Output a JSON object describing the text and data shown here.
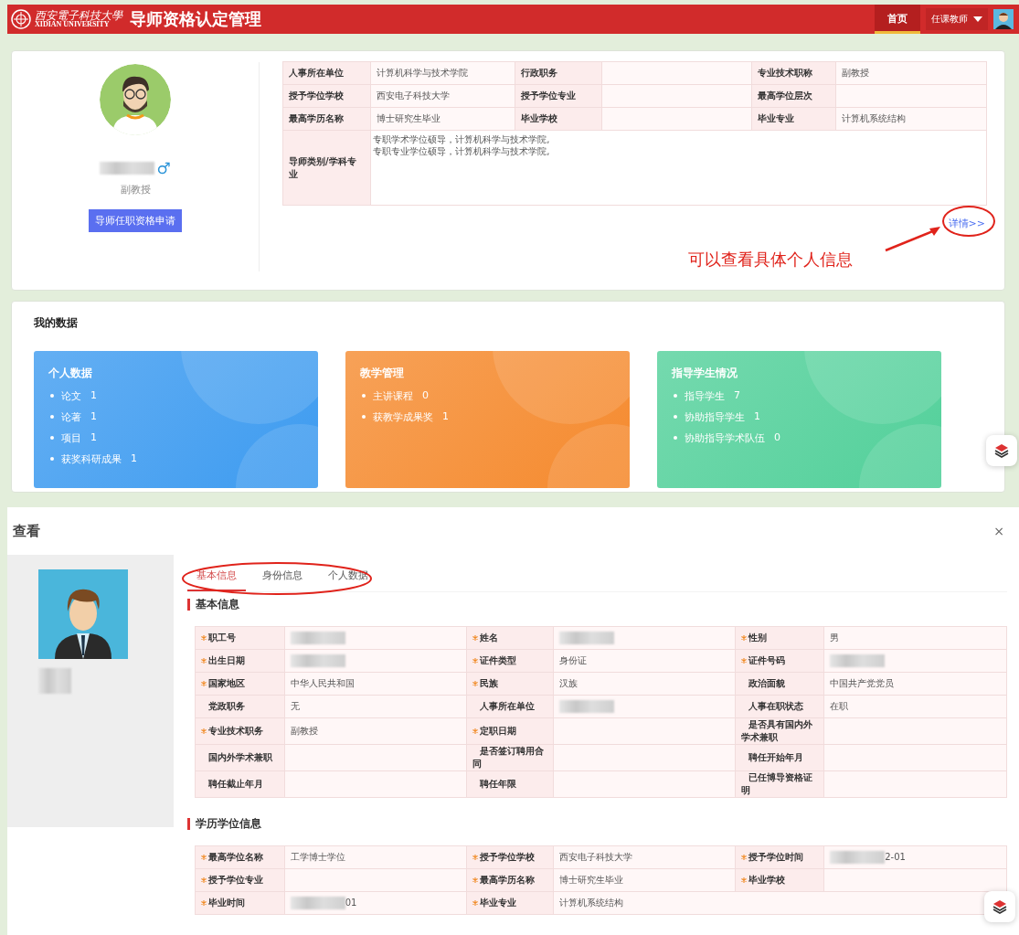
{
  "header": {
    "logo_cn": "西安電子科技大學",
    "logo_en": "XIDIAN UNIVERSITY",
    "title": "导师资格认定管理",
    "nav": [
      {
        "label": "首页",
        "selected": true
      }
    ],
    "role": "任课教师"
  },
  "profile": {
    "name_redacted": true,
    "gender": "♂",
    "rank": "副教授",
    "apply_button": "导师任职资格申请",
    "info_rows": [
      [
        {
          "label": "人事所在单位",
          "value": "计算机科学与技术学院"
        },
        {
          "label": "行政职务"
        },
        {
          "label": "专业技术职称",
          "value": "副教授"
        }
      ],
      [
        {
          "label": "授予学位学校",
          "value": "西安电子科技大学"
        },
        {
          "label": "授予学位专业"
        },
        {
          "label": "最高学位层次"
        }
      ],
      [
        {
          "label": "最高学历名称",
          "value": "博士研究生毕业"
        },
        {
          "label": "毕业学校"
        },
        {
          "label": "毕业专业",
          "value": "计算机系统结构"
        }
      ]
    ],
    "tutor_row": {
      "label": "导师类别/学科专业",
      "lines": [
        "专职学术学位硕导，计算机科学与技术学院,",
        "专职专业学位硕导，计算机科学与技术学院,"
      ]
    },
    "details_link": "详情>>",
    "annotation": "可以查看具体个人信息"
  },
  "my_data": {
    "title": "我的数据",
    "cards": [
      {
        "title": "个人数据",
        "color": "#3d9bf0",
        "items": [
          {
            "label": "论文",
            "count": "1"
          },
          {
            "label": "论著",
            "count": "1"
          },
          {
            "label": "项目",
            "count": "1"
          },
          {
            "label": "获奖科研成果",
            "count": "1"
          }
        ]
      },
      {
        "title": "教学管理",
        "color": "#f58a2e",
        "items": [
          {
            "label": "主讲课程",
            "count": "0"
          },
          {
            "label": "获教学成果奖",
            "count": "1"
          }
        ]
      },
      {
        "title": "指导学生情况",
        "color": "#52d09a",
        "items": [
          {
            "label": "指导学生",
            "count": "7"
          },
          {
            "label": "协助指导学生",
            "count": "1"
          },
          {
            "label": "协助指导学术队伍",
            "count": "0"
          }
        ]
      }
    ]
  },
  "dialog": {
    "title": "查看",
    "close": "×",
    "photo_caption_redacted": true,
    "tabs": [
      {
        "label": "基本信息",
        "selected": true
      },
      {
        "label": "身份信息",
        "selected": false
      },
      {
        "label": "个人数据",
        "selected": false
      }
    ],
    "sections": [
      {
        "title": "基本信息",
        "rows": [
          [
            {
              "label": "职工号",
              "required": true,
              "redacted": true
            },
            {
              "label": "姓名",
              "required": true,
              "redacted": true
            },
            {
              "label": "性别",
              "required": true,
              "value": "男"
            }
          ],
          [
            {
              "label": "出生日期",
              "required": true,
              "redacted": true
            },
            {
              "label": "证件类型",
              "required": true,
              "value": "身份证"
            },
            {
              "label": "证件号码",
              "required": true,
              "redacted": true
            }
          ],
          [
            {
              "label": "国家地区",
              "required": true,
              "value": "中华人民共和国"
            },
            {
              "label": "民族",
              "required": true,
              "value": "汉族"
            },
            {
              "label": "政治面貌",
              "required": false,
              "value": "中国共产党党员"
            }
          ],
          [
            {
              "label": "党政职务",
              "required": false,
              "value": "无"
            },
            {
              "label": "人事所在单位",
              "required": false,
              "redacted": true
            },
            {
              "label": "人事在职状态",
              "required": false,
              "value": "在职"
            }
          ],
          [
            {
              "label": "专业技术职务",
              "required": true,
              "value": "副教授"
            },
            {
              "label": "定职日期",
              "required": true
            },
            {
              "label": "是否具有国内外学术兼职",
              "required": false
            }
          ],
          [
            {
              "label": "国内外学术兼职",
              "required": false
            },
            {
              "label": "是否签订聘用合同",
              "required": false
            },
            {
              "label": "聘任开始年月",
              "required": false
            }
          ],
          [
            {
              "label": "聘任截止年月",
              "required": false
            },
            {
              "label": "聘任年限",
              "required": false
            },
            {
              "label": "已任博导资格证明",
              "required": false
            }
          ]
        ]
      },
      {
        "title": "学历学位信息",
        "rows": [
          [
            {
              "label": "最高学位名称",
              "required": true,
              "value": "工学博士学位"
            },
            {
              "label": "授予学位学校",
              "required": true,
              "value": "西安电子科技大学"
            },
            {
              "label": "授予学位时间",
              "required": true,
              "redacted": true,
              "value": "2-01"
            }
          ],
          [
            {
              "label": "授予学位专业",
              "required": true
            },
            {
              "label": "最高学历名称",
              "required": true,
              "value": "博士研究生毕业"
            },
            {
              "label": "毕业学校",
              "required": true
            }
          ],
          [
            {
              "label": "毕业时间",
              "required": true,
              "redacted": true,
              "value": "01"
            },
            {
              "label": "毕业专业",
              "required": true,
              "value": "计算机系统结构"
            }
          ]
        ]
      }
    ]
  }
}
